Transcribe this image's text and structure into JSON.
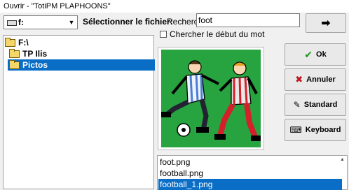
{
  "window": {
    "title": "Ouvrir - \"TotiPM PLAPHOONS\""
  },
  "drive": {
    "value": "f:",
    "icon": "drive-icon"
  },
  "labels": {
    "select_file": "Sélectionner le fichier:",
    "search": "Recherch",
    "check_start": "Chercher le début du mot"
  },
  "search": {
    "value": "foot"
  },
  "go_button": {
    "label": "➡"
  },
  "tree": [
    {
      "label": "F:\\",
      "icon": "open-folder-icon",
      "selected": false
    },
    {
      "label": "TP Ilis",
      "icon": "open-folder-icon",
      "selected": false
    },
    {
      "label": "Pictos",
      "icon": "open-folder-icon",
      "selected": true
    }
  ],
  "buttons": {
    "ok": "Ok",
    "cancel": "Annuler",
    "standard": "Standard",
    "keyboard": "Keyboard"
  },
  "files": [
    {
      "name": "foot.png",
      "selected": false
    },
    {
      "name": "football.png",
      "selected": false
    },
    {
      "name": "football_1.png",
      "selected": true
    }
  ],
  "colors": {
    "selection": "#0a6ec7",
    "pitch": "#27a33f"
  }
}
